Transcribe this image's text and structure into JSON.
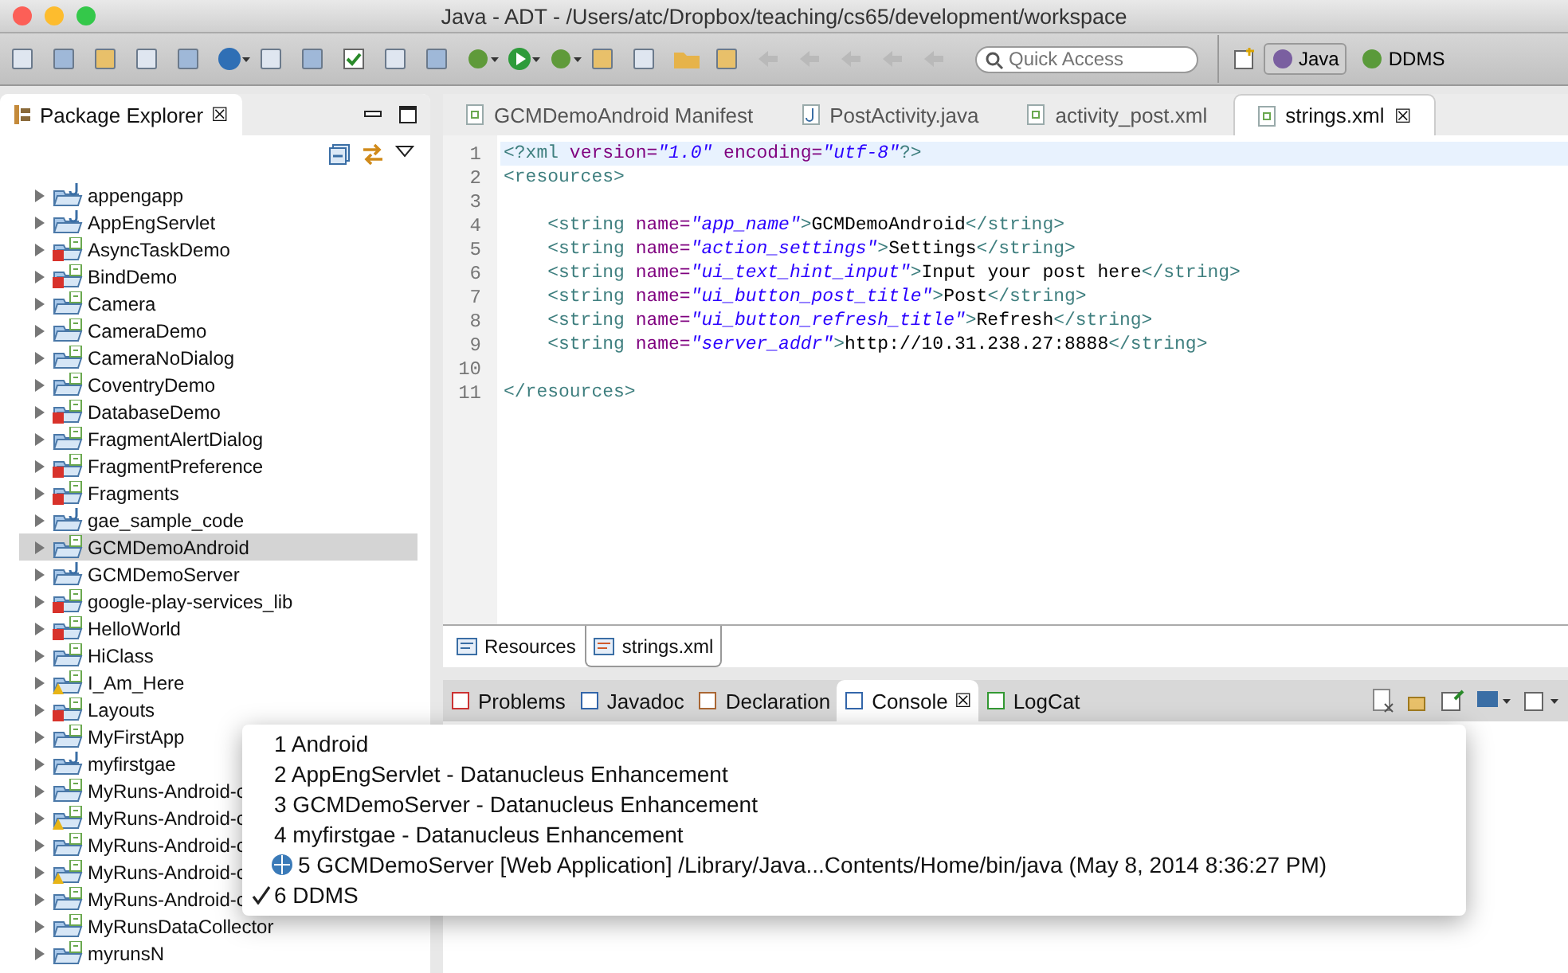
{
  "window": {
    "title": "Java - ADT - /Users/atc/Dropbox/teaching/cs65/development/workspace"
  },
  "toolbar": {
    "quick_access": {
      "placeholder": "Quick Access"
    },
    "perspectives": [
      {
        "label": "Java",
        "selected": true
      },
      {
        "label": "DDMS",
        "selected": false
      }
    ]
  },
  "package_explorer": {
    "title": "Package Explorer",
    "close": "☒",
    "projects": [
      {
        "label": "appengapp",
        "kind": "java",
        "error": false,
        "warning": false,
        "selected": false
      },
      {
        "label": "AppEngServlet",
        "kind": "java",
        "error": false,
        "warning": false,
        "selected": false
      },
      {
        "label": "AsyncTaskDemo",
        "kind": "android",
        "error": true,
        "warning": false,
        "selected": false
      },
      {
        "label": "BindDemo",
        "kind": "android",
        "error": true,
        "warning": false,
        "selected": false
      },
      {
        "label": "Camera",
        "kind": "android",
        "error": false,
        "warning": false,
        "selected": false
      },
      {
        "label": "CameraDemo",
        "kind": "android",
        "error": false,
        "warning": false,
        "selected": false
      },
      {
        "label": "CameraNoDialog",
        "kind": "android",
        "error": false,
        "warning": false,
        "selected": false
      },
      {
        "label": "CoventryDemo",
        "kind": "android",
        "error": false,
        "warning": false,
        "selected": false
      },
      {
        "label": "DatabaseDemo",
        "kind": "android",
        "error": true,
        "warning": false,
        "selected": false
      },
      {
        "label": "FragmentAlertDialog",
        "kind": "android",
        "error": false,
        "warning": false,
        "selected": false
      },
      {
        "label": "FragmentPreference",
        "kind": "android",
        "error": true,
        "warning": false,
        "selected": false
      },
      {
        "label": "Fragments",
        "kind": "android",
        "error": true,
        "warning": false,
        "selected": false
      },
      {
        "label": "gae_sample_code",
        "kind": "java",
        "error": false,
        "warning": false,
        "selected": false
      },
      {
        "label": "GCMDemoAndroid",
        "kind": "android",
        "error": false,
        "warning": false,
        "selected": true
      },
      {
        "label": "GCMDemoServer",
        "kind": "java",
        "error": false,
        "warning": false,
        "selected": false
      },
      {
        "label": "google-play-services_lib",
        "kind": "android",
        "error": true,
        "warning": false,
        "selected": false
      },
      {
        "label": "HelloWorld",
        "kind": "android",
        "error": true,
        "warning": false,
        "selected": false
      },
      {
        "label": "HiClass",
        "kind": "android",
        "error": false,
        "warning": false,
        "selected": false
      },
      {
        "label": "I_Am_Here",
        "kind": "android",
        "error": false,
        "warning": true,
        "selected": false
      },
      {
        "label": "Layouts",
        "kind": "android",
        "error": true,
        "warning": false,
        "selected": false
      },
      {
        "label": "MyFirstApp",
        "kind": "android",
        "error": false,
        "warning": false,
        "selected": false
      },
      {
        "label": "myfirstgae",
        "kind": "java",
        "error": false,
        "warning": false,
        "selected": false
      },
      {
        "label": "MyRuns-Android-c",
        "kind": "android",
        "error": false,
        "warning": false,
        "selected": false
      },
      {
        "label": "MyRuns-Android-c",
        "kind": "android",
        "error": false,
        "warning": true,
        "selected": false
      },
      {
        "label": "MyRuns-Android-c",
        "kind": "android",
        "error": false,
        "warning": false,
        "selected": false
      },
      {
        "label": "MyRuns-Android-c",
        "kind": "android",
        "error": false,
        "warning": true,
        "selected": false
      },
      {
        "label": "MyRuns-Android-c",
        "kind": "android",
        "error": false,
        "warning": false,
        "selected": false
      },
      {
        "label": "MyRunsDataCollector",
        "kind": "android",
        "error": false,
        "warning": false,
        "selected": false
      },
      {
        "label": "myrunsN",
        "kind": "android",
        "error": false,
        "warning": false,
        "selected": false
      }
    ]
  },
  "editor": {
    "tabs": [
      {
        "label": "GCMDemoAndroid Manifest",
        "kind": "android",
        "selected": false
      },
      {
        "label": "PostActivity.java",
        "kind": "java",
        "selected": false
      },
      {
        "label": "activity_post.xml",
        "kind": "android",
        "selected": false
      },
      {
        "label": "strings.xml",
        "kind": "android",
        "selected": true,
        "close": "☒"
      }
    ],
    "lines": [
      {
        "number": "1",
        "current": true,
        "segments": [
          {
            "kind": "tag",
            "text": "<?xml "
          },
          {
            "kind": "attr",
            "text": "version="
          },
          {
            "kind": "value",
            "text": "\"1.0\""
          },
          {
            "kind": "attr",
            "text": " encoding="
          },
          {
            "kind": "value",
            "text": "\"utf-8\""
          },
          {
            "kind": "tag",
            "text": "?>"
          }
        ]
      },
      {
        "number": "2",
        "current": false,
        "segments": [
          {
            "kind": "tag",
            "text": "<resources>"
          }
        ]
      },
      {
        "number": "3",
        "current": false
      },
      {
        "number": "4",
        "current": false,
        "segments": [
          {
            "kind": "tag",
            "text": "    <string "
          },
          {
            "kind": "attr",
            "text": "name="
          },
          {
            "kind": "value",
            "text": "\"app_name\""
          },
          {
            "kind": "tag",
            "text": ">"
          },
          {
            "kind": "text",
            "text": "GCMDemoAndroid"
          },
          {
            "kind": "tag",
            "text": "</string>"
          }
        ]
      },
      {
        "number": "5",
        "current": false,
        "segments": [
          {
            "kind": "tag",
            "text": "    <string "
          },
          {
            "kind": "attr",
            "text": "name="
          },
          {
            "kind": "value",
            "text": "\"action_settings\""
          },
          {
            "kind": "tag",
            "text": ">"
          },
          {
            "kind": "text",
            "text": "Settings"
          },
          {
            "kind": "tag",
            "text": "</string>"
          }
        ]
      },
      {
        "number": "6",
        "current": false,
        "segments": [
          {
            "kind": "tag",
            "text": "    <string "
          },
          {
            "kind": "attr",
            "text": "name="
          },
          {
            "kind": "value",
            "text": "\"ui_text_hint_input\""
          },
          {
            "kind": "tag",
            "text": ">"
          },
          {
            "kind": "text",
            "text": "Input your post here"
          },
          {
            "kind": "tag",
            "text": "</string>"
          }
        ]
      },
      {
        "number": "7",
        "current": false,
        "segments": [
          {
            "kind": "tag",
            "text": "    <string "
          },
          {
            "kind": "attr",
            "text": "name="
          },
          {
            "kind": "value",
            "text": "\"ui_button_post_title\""
          },
          {
            "kind": "tag",
            "text": ">"
          },
          {
            "kind": "text",
            "text": "Post"
          },
          {
            "kind": "tag",
            "text": "</string>"
          }
        ]
      },
      {
        "number": "8",
        "current": false,
        "segments": [
          {
            "kind": "tag",
            "text": "    <string "
          },
          {
            "kind": "attr",
            "text": "name="
          },
          {
            "kind": "value",
            "text": "\"ui_button_refresh_title\""
          },
          {
            "kind": "tag",
            "text": ">"
          },
          {
            "kind": "text",
            "text": "Refresh"
          },
          {
            "kind": "tag",
            "text": "</string>"
          }
        ]
      },
      {
        "number": "9",
        "current": false,
        "segments": [
          {
            "kind": "tag",
            "text": "    <string "
          },
          {
            "kind": "attr",
            "text": "name="
          },
          {
            "kind": "value",
            "text": "\"server_addr\""
          },
          {
            "kind": "tag",
            "text": ">"
          },
          {
            "kind": "text",
            "text": "http://10.31.238.27:8888"
          },
          {
            "kind": "tag",
            "text": "</string>"
          }
        ]
      },
      {
        "number": "10",
        "current": false
      },
      {
        "number": "11",
        "current": false,
        "segments": [
          {
            "kind": "tag",
            "text": "</resources>"
          }
        ]
      }
    ],
    "bottom_tabs": [
      {
        "label": "Resources",
        "selected": false
      },
      {
        "label": "strings.xml",
        "selected": true
      }
    ]
  },
  "views": {
    "tabs": [
      {
        "label": "Problems",
        "selected": false
      },
      {
        "label": "Javadoc",
        "selected": false
      },
      {
        "label": "Declaration",
        "selected": false
      },
      {
        "label": "Console",
        "selected": true,
        "close": "☒"
      },
      {
        "label": "LogCat",
        "selected": false
      }
    ]
  },
  "console_menu": {
    "items": [
      {
        "label": "1 Android",
        "checked": false,
        "running": false
      },
      {
        "label": "2 AppEngServlet - Datanucleus Enhancement",
        "checked": false,
        "running": false
      },
      {
        "label": "3 GCMDemoServer - Datanucleus Enhancement",
        "checked": false,
        "running": false
      },
      {
        "label": "4 myfirstgae - Datanucleus Enhancement",
        "checked": false,
        "running": false
      },
      {
        "label": "5 GCMDemoServer [Web Application] /Library/Java...Contents/Home/bin/java (May 8, 2014 8:36:27 PM)",
        "checked": false,
        "running": true
      },
      {
        "label": "6 DDMS",
        "checked": true,
        "running": false
      }
    ]
  }
}
